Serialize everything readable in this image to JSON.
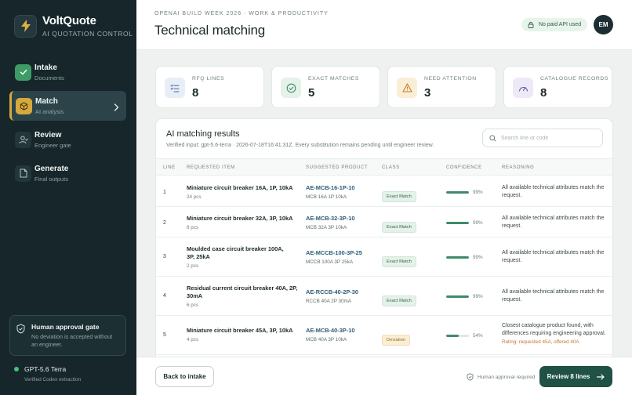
{
  "brand": {
    "name": "VoltQuote",
    "subtitle": "AI QUOTATION CONTROL"
  },
  "nav": [
    {
      "label": "Intake",
      "sub": "Documents",
      "state": "done",
      "icon": "check-icon"
    },
    {
      "label": "Match",
      "sub": "AI analysis",
      "state": "active",
      "icon": "cube-icon"
    },
    {
      "label": "Review",
      "sub": "Engineer gate",
      "state": "pending",
      "icon": "user-check-icon"
    },
    {
      "label": "Generate",
      "sub": "Final outputs",
      "state": "pending",
      "icon": "document-icon"
    }
  ],
  "gate": {
    "title": "Human approval gate",
    "desc": "No deviation is accepted without an engineer."
  },
  "model": {
    "name": "GPT-5.6 Terra",
    "sub": "Verified Codex extraction"
  },
  "header": {
    "eyebrow": "OPENAI BUILD WEEK 2026 · WORK & PRODUCTIVITY",
    "title": "Technical matching",
    "api_badge": "No paid API used",
    "avatar": "EM"
  },
  "stats": [
    {
      "label": "RFQ LINES",
      "value": "8",
      "icon": "list-check-icon",
      "color": "#e8eef8"
    },
    {
      "label": "EXACT MATCHES",
      "value": "5",
      "icon": "check-circle-icon",
      "color": "#e4f2ea"
    },
    {
      "label": "NEED ATTENTION",
      "value": "3",
      "icon": "warning-icon",
      "color": "#fbeed6"
    },
    {
      "label": "CATALOGUE RECORDS",
      "value": "8",
      "icon": "gauge-icon",
      "color": "#ede9f7"
    }
  ],
  "results": {
    "title": "AI matching results",
    "meta": "Verified input: gpt-5.6-terra · 2026-07-18T16:41:31Z. Every substitution remains pending until engineer review.",
    "search_placeholder": "Search line or code",
    "columns": {
      "line": "LINE",
      "item": "REQUESTED ITEM",
      "product": "SUGGESTED PRODUCT",
      "class": "CLASS",
      "confidence": "CONFIDENCE",
      "reasoning": "REASONING"
    },
    "rows": [
      {
        "line": "1",
        "item": "Miniature circuit breaker 16A, 1P, 10kA",
        "qty": "24 pcs",
        "code": "AE-MCB-16-1P-10",
        "desc": "MCB 16A 1P 10kA",
        "class": "Exact Match",
        "kind": "exact",
        "confidence": 0.99,
        "confidence_label": "99%",
        "reasoning": "All available technical attributes match the request.",
        "note": ""
      },
      {
        "line": "2",
        "item": "Miniature circuit breaker 32A, 3P, 10kA",
        "qty": "8 pcs",
        "code": "AE-MCB-32-3P-10",
        "desc": "MCB 32A 3P 10kA",
        "class": "Exact Match",
        "kind": "exact",
        "confidence": 0.99,
        "confidence_label": "99%",
        "reasoning": "All available technical attributes match the request.",
        "note": ""
      },
      {
        "line": "3",
        "item": "Moulded case circuit breaker 100A, 3P, 25kA",
        "qty": "2 pcs",
        "code": "AE-MCCB-100-3P-25",
        "desc": "MCCB 100A 3P 25kA",
        "class": "Exact Match",
        "kind": "exact",
        "confidence": 0.99,
        "confidence_label": "99%",
        "reasoning": "All available technical attributes match the request.",
        "note": ""
      },
      {
        "line": "4",
        "item": "Residual current circuit breaker 40A, 2P, 30mA",
        "qty": "6 pcs",
        "code": "AE-RCCB-40-2P-30",
        "desc": "RCCB 40A 2P 30mA",
        "class": "Exact Match",
        "kind": "exact",
        "confidence": 0.99,
        "confidence_label": "99%",
        "reasoning": "All available technical attributes match the request.",
        "note": ""
      },
      {
        "line": "5",
        "item": "Miniature circuit breaker 45A, 3P, 10kA",
        "qty": "4 pcs",
        "code": "AE-MCB-40-3P-10",
        "desc": "MCB 40A 3P 10kA",
        "class": "Deviation",
        "kind": "dev",
        "confidence": 0.54,
        "confidence_label": "54%",
        "reasoning": "Closest catalogue product found, with differences requiring engineering approval.",
        "note": "Rating: requested 45A, offered 40A"
      }
    ]
  },
  "footer": {
    "back": "Back to intake",
    "approval": "Human approval required",
    "review": "Review 8 lines"
  }
}
